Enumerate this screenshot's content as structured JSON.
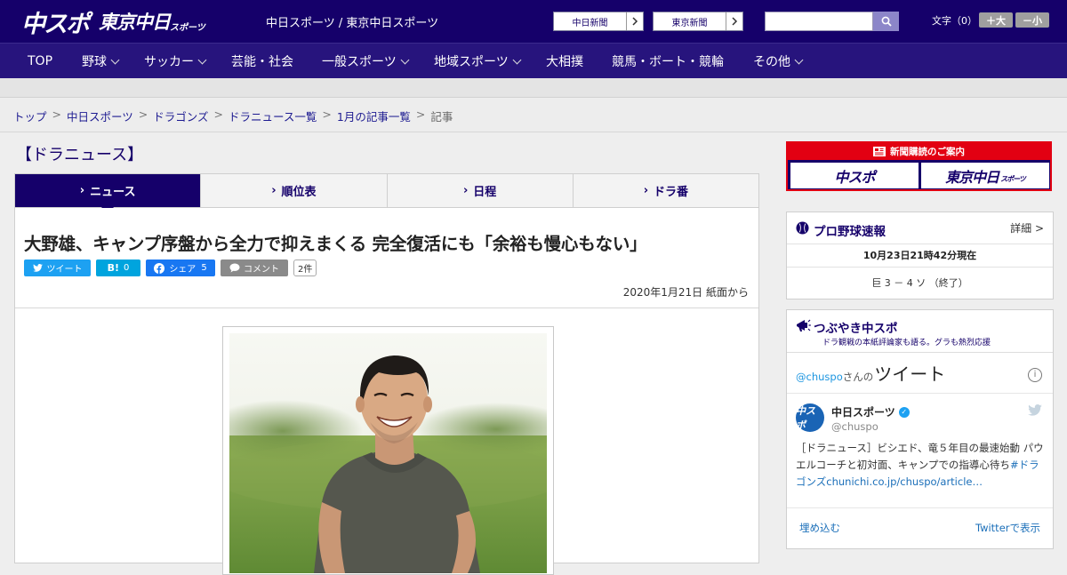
{
  "header": {
    "logo_main": "中スポ",
    "logo_sub": "東京中日",
    "logo_sub_small": "スポーツ",
    "site_names": "中日スポーツ / 東京中日スポーツ",
    "paper_links": [
      "中日新聞",
      "東京新聞"
    ],
    "search_placeholder": "",
    "font_size_label": "文字（0）",
    "font_plus": "＋大",
    "font_minus": "－小"
  },
  "nav": {
    "items": [
      {
        "label": "TOP",
        "caret": false
      },
      {
        "label": "野球",
        "caret": true
      },
      {
        "label": "サッカー",
        "caret": true
      },
      {
        "label": "芸能・社会",
        "caret": false
      },
      {
        "label": "一般スポーツ",
        "caret": true
      },
      {
        "label": "地域スポーツ",
        "caret": true
      },
      {
        "label": "大相撲",
        "caret": false
      },
      {
        "label": "競馬・ボート・競輪",
        "caret": false
      },
      {
        "label": "その他",
        "caret": true
      }
    ]
  },
  "breadcrumb": {
    "items": [
      "トップ",
      "中日スポーツ",
      "ドラゴンズ",
      "ドラニュース一覧",
      "1月の記事一覧"
    ],
    "current": "記事"
  },
  "section": {
    "title": "【ドラニュース】"
  },
  "tabs": [
    {
      "label": "ニュース",
      "active": true
    },
    {
      "label": "順位表",
      "active": false
    },
    {
      "label": "日程",
      "active": false
    },
    {
      "label": "ドラ番",
      "active": false
    }
  ],
  "article": {
    "headline": "大野雄、キャンプ序盤から全力で抑えまくる 完全復活にも「余裕も慢心もない」",
    "share": {
      "tweet": "ツイート",
      "hatena_icon": "B!",
      "hatena_count": "0",
      "facebook": "シェア",
      "facebook_count": "5",
      "comment": "コメント",
      "comment_count": "2件"
    },
    "dateline": "2020年1月21日 紙面から"
  },
  "sidebar": {
    "subscribe": {
      "header": "新聞購読のご案内",
      "btn1": "中スポ",
      "btn2": "東京中日",
      "btn2_small": "スポーツ"
    },
    "score": {
      "title": "プロ野球速報",
      "more": "詳細 >",
      "time": "10月23日21時42分現在",
      "game": "巨 3 － 4 ソ （終了）"
    },
    "twitter": {
      "title": "つぶやき中スポ",
      "subtitle": "ドラ観戦の本紙評論家も語る。グラも熱烈応援",
      "handle_prefix": "@chuspo",
      "san_no": "さんの",
      "tweet_word": "ツイート",
      "info": "i",
      "avatar_text": "中スポ",
      "account_name": "中日スポーツ",
      "account_handle": "@chuspo",
      "tweet_text": "［ドラニュース］ビシエド、竜５年目の最速始動 パウエルコーチと初対面、キャンプでの指導心待ち",
      "tweet_link": "#ドラゴンズchunichi.co.jp/chuspo/article…",
      "embed": "埋め込む",
      "view": "Twitterで表示"
    }
  },
  "colors": {
    "brand": "#15006a",
    "nav": "#27147d",
    "twitter": "#1da1f2",
    "facebook": "#1877f2",
    "hatena": "#00a4de",
    "subscribe_red": "#e20012"
  }
}
